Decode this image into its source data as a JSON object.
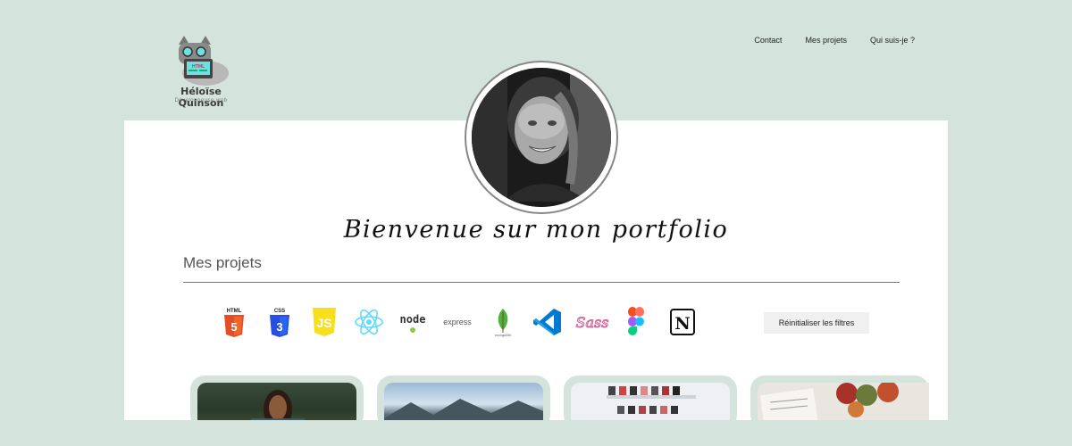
{
  "brand": {
    "name": "Héloïse Quinson",
    "subtitle": "Développeuse web",
    "logo_screen_text": "HTML"
  },
  "nav": {
    "items": [
      "Contact",
      "Mes projets",
      "Qui suis-je ?"
    ]
  },
  "hero": {
    "welcome": "Bienvenue sur mon portfolio"
  },
  "projects_section": {
    "title": "Mes projets",
    "reset_label": "Réinitialiser les filtres",
    "filters": [
      {
        "name": "html5-icon",
        "label": "HTML"
      },
      {
        "name": "css3-icon",
        "label": "CSS"
      },
      {
        "name": "javascript-icon",
        "label": "JS"
      },
      {
        "name": "react-icon",
        "label": ""
      },
      {
        "name": "nodejs-icon",
        "label": "node"
      },
      {
        "name": "express-icon",
        "label": "express"
      },
      {
        "name": "mongodb-icon",
        "label": "mongoDB"
      },
      {
        "name": "vscode-icon",
        "label": ""
      },
      {
        "name": "sass-icon",
        "label": "Sass"
      },
      {
        "name": "figma-icon",
        "label": ""
      },
      {
        "name": "notion-icon",
        "label": "N"
      }
    ]
  },
  "colors": {
    "background": "#d4e3dc",
    "card": "#ffffff",
    "html": "#e44d26",
    "css": "#264de4",
    "js": "#f7df1e",
    "react": "#61dafb",
    "sass": "#cd6799",
    "vscode": "#007acc",
    "mongo": "#4db33d"
  }
}
